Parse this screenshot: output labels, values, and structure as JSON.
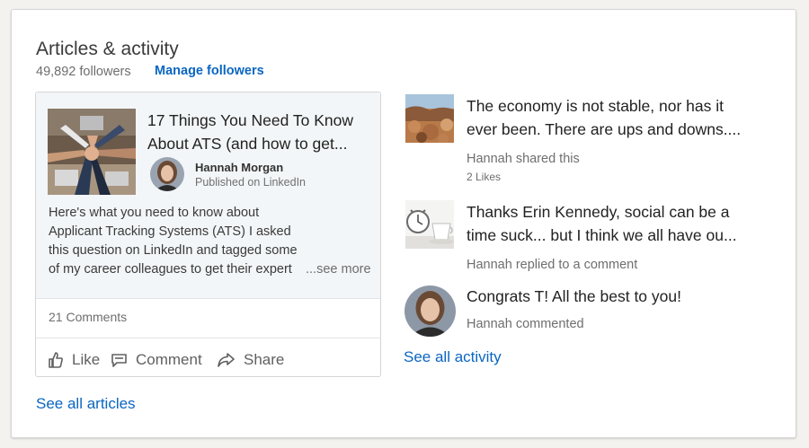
{
  "section": {
    "title": "Articles & activity",
    "followers": "49,892 followers",
    "manage_label": "Manage followers",
    "see_all_articles": "See all articles",
    "see_all_activity": "See all activity"
  },
  "article": {
    "title_line1": "17 Things You Need To Know",
    "title_line2": "About ATS (and how to get...",
    "author": "Hannah Morgan",
    "published": "Published on LinkedIn",
    "excerpt": "Here's what you need to know about Applicant Tracking Systems (ATS) I asked this question on LinkedIn and tagged some of my career colleagues to get their expert tips. In order to be su",
    "see_more": "...see more",
    "comments": "21 Comments",
    "actions": {
      "like": "Like",
      "comment": "Comment",
      "share": "Share"
    }
  },
  "activity": [
    {
      "line1": "The economy is not stable, nor has it",
      "line2": "ever been. There are ups and downs....",
      "meta": "Hannah shared this",
      "likes": "2 Likes",
      "thumb_icon": "rocky-landscape-thumbnail"
    },
    {
      "line1": "Thanks Erin Kennedy, social can be a",
      "line2": "time suck... but I think we all have ou...",
      "meta": "Hannah replied to a comment",
      "thumb_icon": "clock-coffee-thumbnail"
    },
    {
      "line1": "Congrats T! All the best to you!",
      "meta": "Hannah commented",
      "thumb_icon": "avatar"
    }
  ],
  "colors": {
    "link": "#0a66c2",
    "card_bg": "#f3f6f8",
    "text": "#222222",
    "muted": "#6e6e6e"
  }
}
